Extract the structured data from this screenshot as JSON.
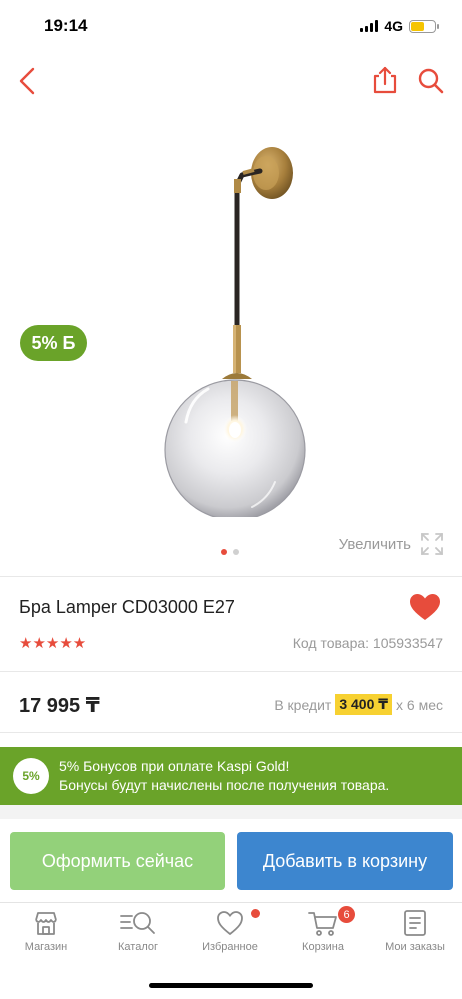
{
  "status_bar": {
    "time": "19:14",
    "network": "4G"
  },
  "header": {
    "back_icon": "chevron-left-icon",
    "share_icon": "share-icon",
    "search_icon": "search-icon"
  },
  "gallery": {
    "bonus_badge": "5% Б",
    "slide_count": 2,
    "active_slide": 1,
    "zoom_label": "Увеличить",
    "zoom_icon": "expand-icon"
  },
  "product": {
    "title": "Бра Lamper CD03000 E27",
    "rating_stars": "★★★★★",
    "rating_value": 5,
    "sku": "Код товара: 105933547"
  },
  "price": {
    "amount": "17 995 ₸",
    "credit_prefix": "В кредит",
    "credit_amount": "3 400 ₸",
    "credit_suffix": "х 6 мес"
  },
  "promo": {
    "badge": "5%",
    "line1": "5% Бонусов при оплате Kaspi Gold!",
    "line2": "Бонусы будут начислены после получения товара."
  },
  "actions": {
    "buy_now": "Оформить сейчас",
    "add_to_cart": "Добавить в корзину"
  },
  "tabbar": {
    "items": [
      {
        "label": "Магазин",
        "icon": "shop-icon"
      },
      {
        "label": "Каталог",
        "icon": "catalog-icon"
      },
      {
        "label": "Избранное",
        "icon": "heart-icon"
      },
      {
        "label": "Корзина",
        "icon": "cart-icon",
        "badge": "6"
      },
      {
        "label": "Мои заказы",
        "icon": "orders-icon"
      }
    ]
  },
  "colors": {
    "accent_red": "#e74c3c",
    "kaspi_green": "#6aa329",
    "buy_button": "#93d17a",
    "cart_button": "#3d86cf",
    "credit_highlight": "#f7d131"
  }
}
